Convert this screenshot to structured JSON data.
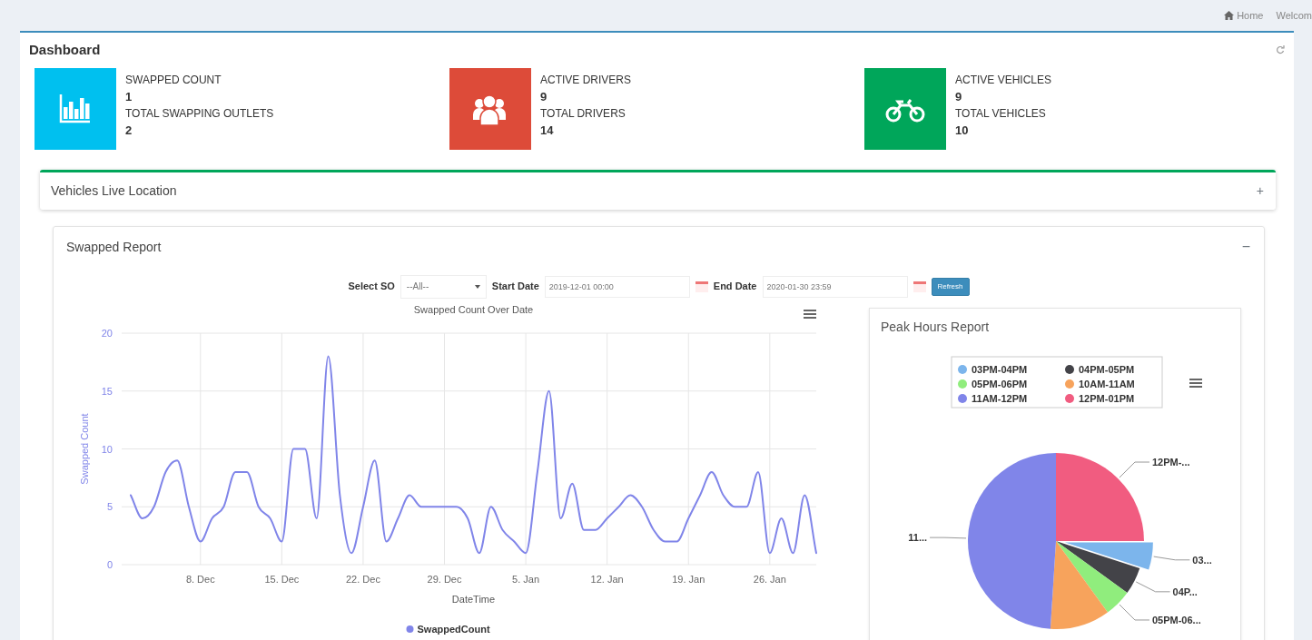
{
  "breadcrumb": [
    {
      "label": "Home",
      "kind": "home"
    },
    {
      "label": "Welcom",
      "kind": "text"
    }
  ],
  "dashboard": {
    "title": "Dashboard"
  },
  "stats": [
    {
      "kind": "chart",
      "color": "#00c0ef",
      "label1": "SWAPPED COUNT",
      "value1": "1",
      "label2": "TOTAL SWAPPING OUTLETS",
      "value2": "2"
    },
    {
      "kind": "users",
      "color": "#dd4b39",
      "label1": "ACTIVE DRIVERS",
      "value1": "9",
      "label2": "TOTAL DRIVERS",
      "value2": "14"
    },
    {
      "kind": "motorcycle",
      "color": "#00a65a",
      "label1": "ACTIVE VEHICLES",
      "value1": "9",
      "label2": "TOTAL VEHICLES",
      "value2": "10"
    }
  ],
  "live_location": {
    "title": "Vehicles Live Location",
    "toggle": "+"
  },
  "swapped_report": {
    "title": "Swapped Report",
    "toggle": "−",
    "filters": {
      "so_label": "Select SO",
      "so_value": "--All--",
      "start_label": "Start Date",
      "start_value": "2019-12-01 00:00",
      "end_label": "End Date",
      "end_value": "2020-01-30 23:59",
      "refresh": "Refresh"
    },
    "line_chart": {
      "chart_data": {
        "type": "line",
        "title": "Swapped Count Over Date",
        "xlabel": "DateTime",
        "ylabel": "Swapped Count",
        "categories": [
          null,
          null,
          null,
          null,
          null,
          null,
          "8. Dec",
          null,
          null,
          null,
          null,
          null,
          null,
          "15. Dec",
          null,
          null,
          null,
          null,
          null,
          null,
          "22. Dec",
          null,
          null,
          null,
          null,
          null,
          null,
          "29. Dec",
          null,
          null,
          null,
          null,
          null,
          null,
          "5. Jan",
          null,
          null,
          null,
          null,
          null,
          null,
          "12. Jan",
          null,
          null,
          null,
          null,
          null,
          null,
          "19. Jan",
          null,
          null,
          null,
          null,
          null,
          null,
          "26. Jan",
          null,
          null,
          null,
          null
        ],
        "series": [
          {
            "name": "SwappedCount",
            "color": "#8085e9",
            "values": [
              6,
              4,
              5,
              8,
              9,
              5,
              2,
              4,
              5,
              8,
              8,
              5,
              4,
              2,
              10,
              10,
              4,
              18,
              6,
              1,
              5,
              9,
              2,
              4,
              6,
              5,
              5,
              5,
              5,
              4,
              1,
              5,
              3,
              2,
              1,
              8,
              15,
              4,
              7,
              3,
              3,
              4,
              5,
              6,
              5,
              3,
              2,
              2,
              4,
              6,
              8,
              6,
              5,
              5,
              8,
              1,
              4,
              1,
              6,
              1
            ]
          }
        ],
        "ylim": [
          0,
          20
        ],
        "yticks": [
          0,
          5,
          10,
          15,
          20
        ],
        "grid": true,
        "legend": "bottom"
      }
    },
    "peak_hours": {
      "title": "Peak Hours Report",
      "chart_data": {
        "type": "pie",
        "categories": [
          "03PM-04PM",
          "04PM-05PM",
          "05PM-06PM",
          "10AM-11AM",
          "11AM-12PM",
          "12PM-01PM"
        ],
        "values": [
          5,
          5,
          5,
          11,
          49,
          25
        ],
        "value_labels": [
          "03...",
          "04P...",
          "05PM-06...",
          null,
          "11...",
          "12PM-..."
        ],
        "legend": "top"
      },
      "slices": [
        {
          "color": "#7cb5ec",
          "sliced": true
        },
        {
          "color": "#434348",
          "sliced": false
        },
        {
          "color": "#90ed7d",
          "sliced": false
        },
        {
          "color": "#f7a35c",
          "sliced": false
        },
        {
          "color": "#8085e9",
          "sliced": false
        },
        {
          "color": "#f15c80",
          "sliced": false
        }
      ]
    }
  }
}
